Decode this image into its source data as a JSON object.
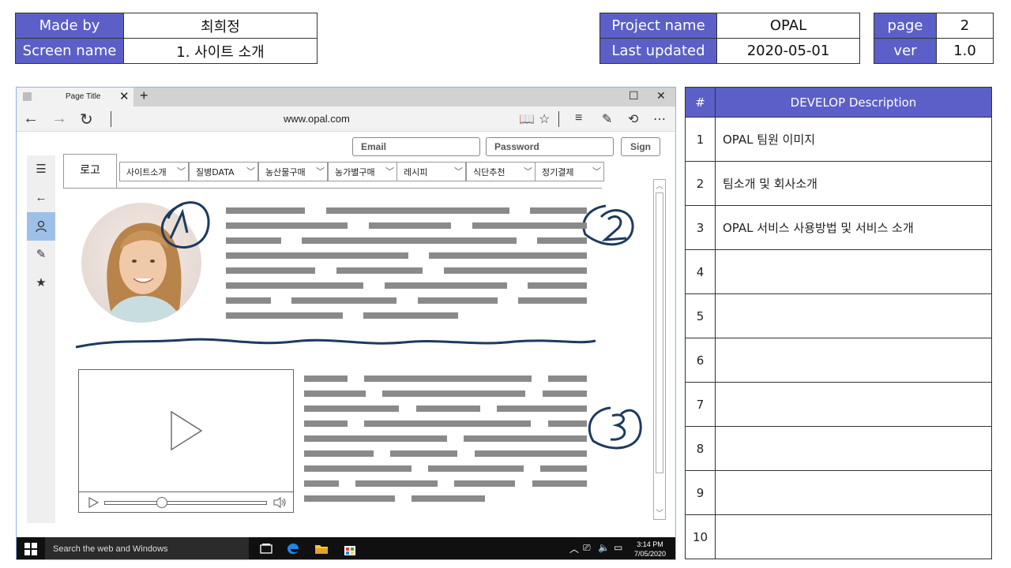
{
  "meta_left": {
    "made_by_label": "Made by",
    "made_by_value": "최희정",
    "screen_name_label": "Screen name",
    "screen_name_value": "1. 사이트 소개"
  },
  "meta_right": {
    "project_name_label": "Project name",
    "project_name_value": "OPAL",
    "last_updated_label": "Last updated",
    "last_updated_value": "2020-05-01"
  },
  "meta_page": {
    "page_label": "page",
    "page_value": "2",
    "ver_label": "ver",
    "ver_value": "1.0"
  },
  "browser": {
    "tab_title": "Page Title",
    "url": "www.opal.com",
    "email_placeholder": "Email",
    "password_placeholder": "Password",
    "sign_label": "Sign",
    "logo_label": "로고",
    "menu": [
      "사이트소개",
      "질병DATA",
      "농산물구매",
      "농가별구매",
      "레시피",
      "식단추천",
      "정기결제"
    ],
    "annotations": [
      "1",
      "2",
      "3"
    ]
  },
  "taskbar": {
    "search_text": "Search the web and Windows",
    "time": "3:14 PM",
    "date": "7/05/2020"
  },
  "description": {
    "col_num": "#",
    "col_desc": "DEVELOP  Description",
    "rows": [
      {
        "num": "1",
        "text": "OPAL 팀원 이미지"
      },
      {
        "num": "2",
        "text": "팀소개 및 회사소개"
      },
      {
        "num": "3",
        "text": "OPAL 서비스 사용방법 및 서비스 소개"
      },
      {
        "num": "4",
        "text": ""
      },
      {
        "num": "5",
        "text": ""
      },
      {
        "num": "6",
        "text": ""
      },
      {
        "num": "7",
        "text": ""
      },
      {
        "num": "8",
        "text": ""
      },
      {
        "num": "9",
        "text": ""
      },
      {
        "num": "10",
        "text": ""
      }
    ]
  },
  "colors": {
    "header_fill": "#5b5fc7",
    "annotation_ink": "#1e3a5f",
    "text_placeholder": "#8a8a8a"
  }
}
